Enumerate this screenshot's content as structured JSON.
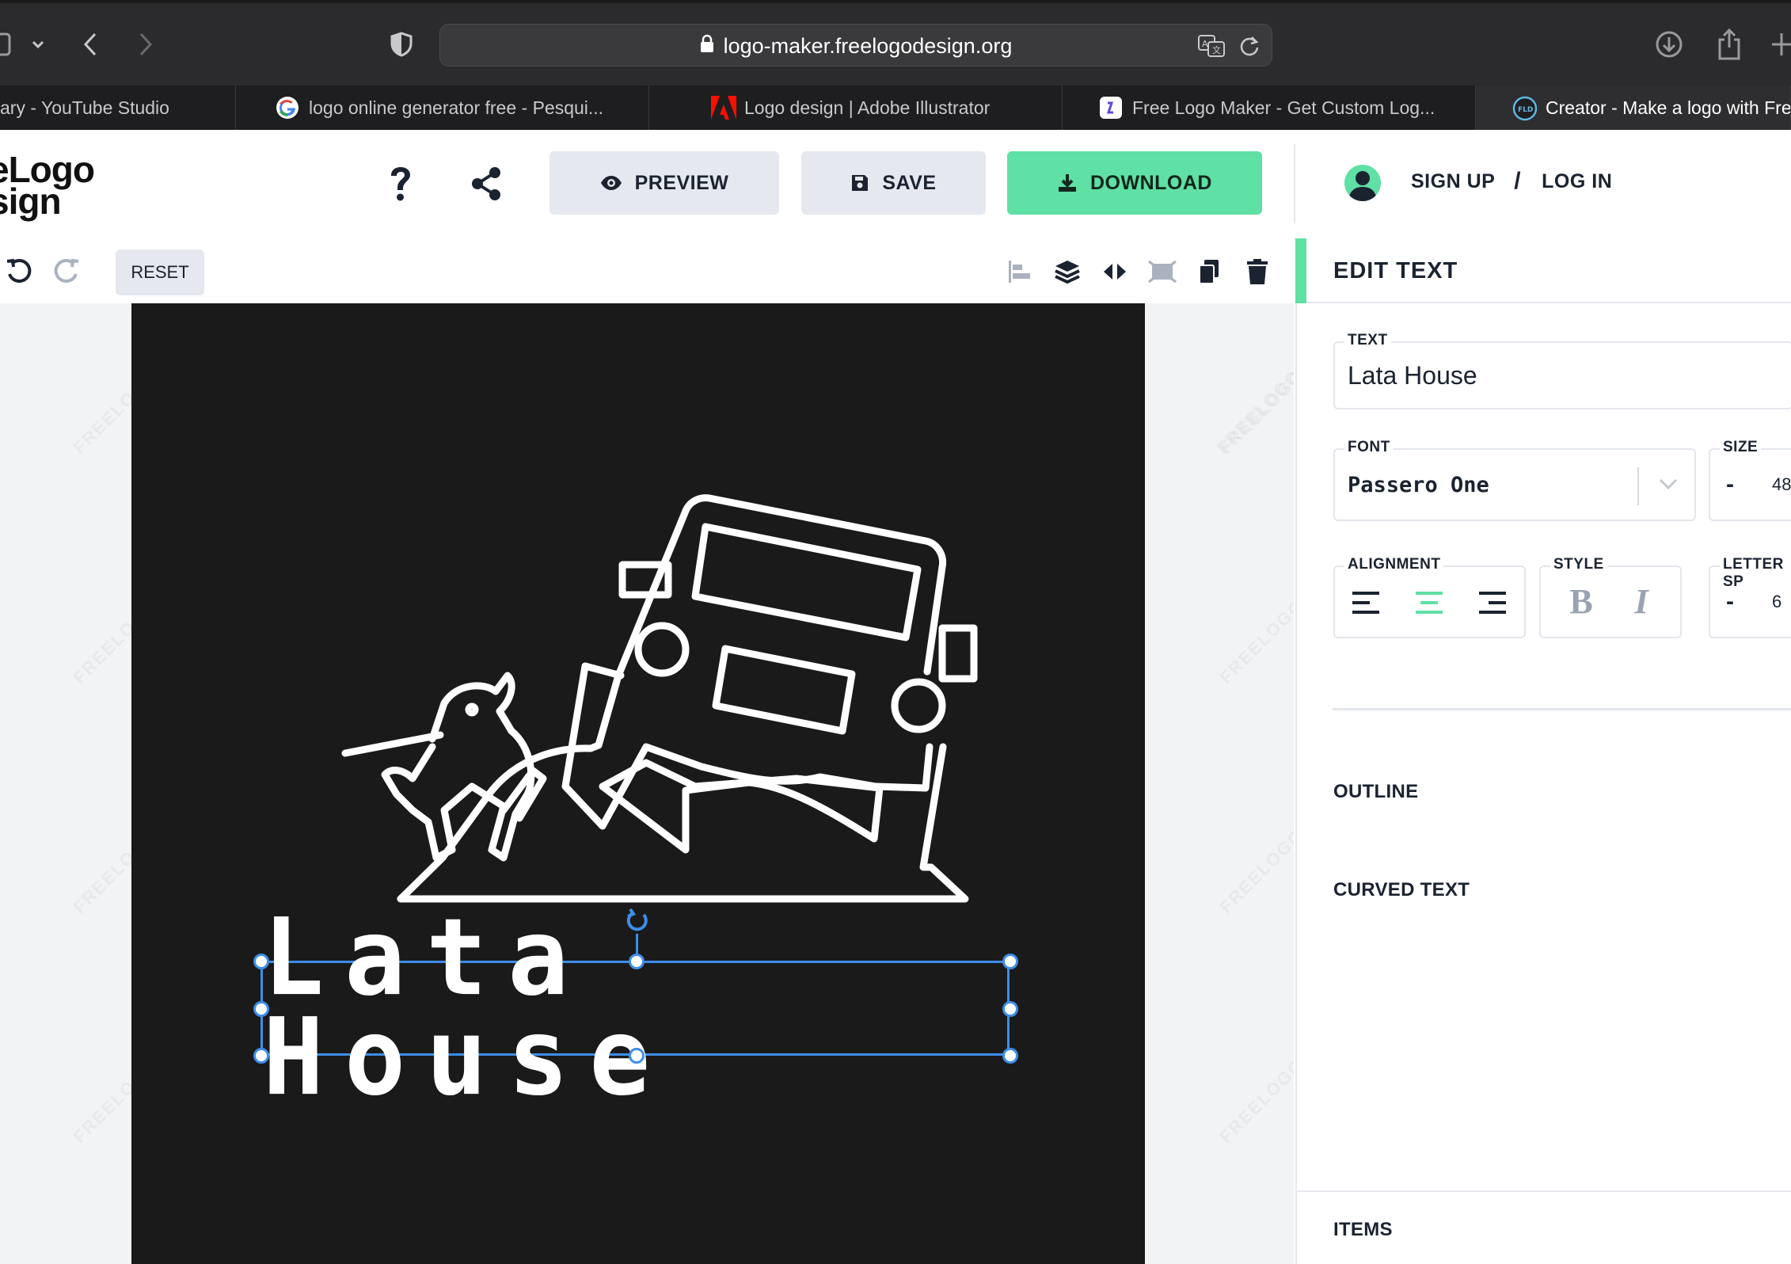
{
  "browser": {
    "url": "logo-maker.freelogodesign.org",
    "tabs": [
      {
        "label": "ary - YouTube Studio",
        "icon": "youtube-studio-favicon"
      },
      {
        "label": "logo online generator free - Pesqui...",
        "icon": "google-favicon"
      },
      {
        "label": "Logo design | Adobe Illustrator",
        "icon": "adobe-favicon"
      },
      {
        "label": "Free Logo Maker - Get Custom Log...",
        "icon": "logo-maker-favicon"
      },
      {
        "label": "Creator - Make a logo with Fre",
        "icon": "fld-favicon",
        "active": true
      }
    ]
  },
  "header": {
    "brand_line1": "eLogo",
    "brand_line2": "sign",
    "preview_label": "PREVIEW",
    "save_label": "SAVE",
    "download_label": "DOWNLOAD",
    "signup_label": "SIGN UP",
    "separator": "/",
    "login_label": "LOG IN"
  },
  "toolbar": {
    "reset_label": "RESET"
  },
  "canvas": {
    "logo_text": "Lata House",
    "watermark": "FREELOGODESIGN",
    "background_color": "#1a1a1b",
    "text_color": "#ffffff",
    "selection_color": "#3d8ee8"
  },
  "panel": {
    "title": "EDIT TEXT",
    "text_label": "TEXT",
    "text_value": "Lata House",
    "font_label": "FONT",
    "font_value": "Passero One",
    "size_label": "SIZE",
    "size_minus": "-",
    "size_value": "48",
    "alignment_label": "ALIGNMENT",
    "alignment_selected": "center",
    "style_label": "STYLE",
    "style_bold": "B",
    "style_italic": "I",
    "letter_spacing_label": "LETTER SP",
    "letter_spacing_minus": "-",
    "letter_spacing_value": "6",
    "outline_label": "OUTLINE",
    "curved_text_label": "CURVED TEXT",
    "items_label": "ITEMS",
    "accent_color": "#5fe0a4"
  }
}
